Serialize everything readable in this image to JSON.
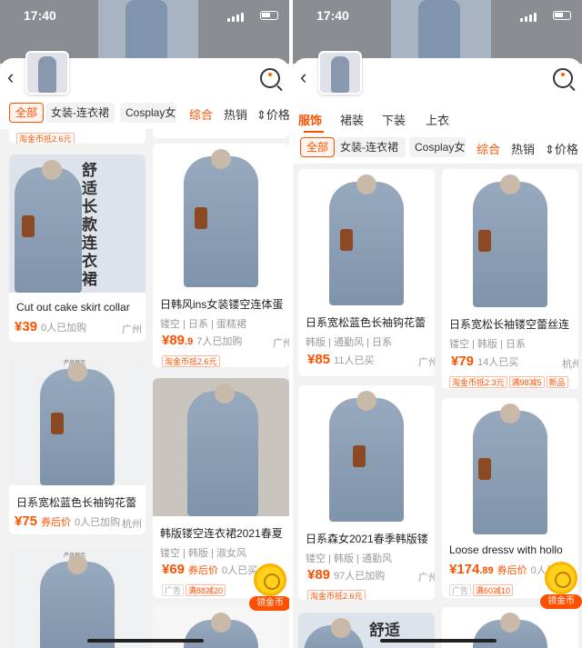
{
  "colors": {
    "accent": "#ff5000",
    "background": "#f2f2f2"
  },
  "left": {
    "status": {
      "time": "17:40"
    },
    "filter_chips": [
      "全部",
      "女装-连衣裙",
      "Cosplay女"
    ],
    "sort": [
      "综合",
      "热销",
      "价格"
    ],
    "top_badge": "淘金币抵2.6元",
    "cards": [
      {
        "vtext": "舒适长款连衣裙",
        "title": "Cut out cake skirt collar",
        "price_int": "39",
        "price_dec": "",
        "coupon": "",
        "sales": "0人已加购",
        "city": "广州",
        "tags": "",
        "badges": []
      },
      {
        "title": "日韩风ins女装镂空连体蛋",
        "tags": "镂空 | 日系 | 蛋糕裙",
        "price_int": "89",
        "price_dec": ".9",
        "coupon": "",
        "sales": "7人已加购",
        "city": "广州",
        "badges": [
          "淘金币抵2.6元"
        ]
      },
      {
        "brandtag": "产品展示",
        "title": "日系宽松蓝色长袖钩花蕾",
        "price_int": "75",
        "price_dec": "",
        "coupon": "券后价",
        "sales": "0人已加购",
        "city": "杭州",
        "tags": "",
        "badges": []
      },
      {
        "title": "韩版镂空连衣裙2021春夏",
        "tags": "镂空 | 韩版 | 淑女风",
        "price_int": "69",
        "price_dec": "",
        "coupon": "券后价",
        "sales": "0人已买",
        "city": "",
        "badges_ad": "广告",
        "badges": [
          "满88减20"
        ]
      },
      {
        "brandtag": "产品展示"
      }
    ],
    "float_label": "领金币"
  },
  "right": {
    "status": {
      "time": "17:40"
    },
    "cat_tabs": [
      "服饰",
      "裙装",
      "下装",
      "上衣"
    ],
    "filter_chips": [
      "全部",
      "女装-连衣裙",
      "Cosplay女"
    ],
    "sort": [
      "综合",
      "热销",
      "价格"
    ],
    "cards": [
      {
        "title": "日系宽松蓝色长袖钩花蕾",
        "tags": "韩版 | 通勤风 | 日系",
        "price_int": "85",
        "price_dec": "",
        "coupon": "",
        "sales": "11人已买",
        "city": "广州",
        "badges": []
      },
      {
        "title": "日系宽松长袖镂空蕾丝连",
        "tags": "镂空 | 韩版 | 日系",
        "price_int": "79",
        "price_dec": "",
        "coupon": "",
        "sales": "14人已买",
        "city": "杭州",
        "badges": [
          "淘金币抵2.3元",
          "满98减5",
          "新品"
        ]
      },
      {
        "title": "日系森女2021春季韩版镂",
        "tags": "镂空 | 韩版 | 通勤风",
        "price_int": "89",
        "price_dec": "",
        "coupon": "",
        "sales": "97人已加购",
        "city": "广州",
        "badges": [
          "淘金币抵2.6元"
        ]
      },
      {
        "title": "Loose dressv with hollo",
        "tags": "",
        "price_int": "174",
        "price_dec": ".89",
        "coupon": "券后价",
        "sales": "0人已买",
        "city": "",
        "badges_ad": "广告",
        "badges": [
          "满60减10"
        ]
      },
      {
        "vtext": "舒适"
      }
    ],
    "float_label": "领金币"
  }
}
